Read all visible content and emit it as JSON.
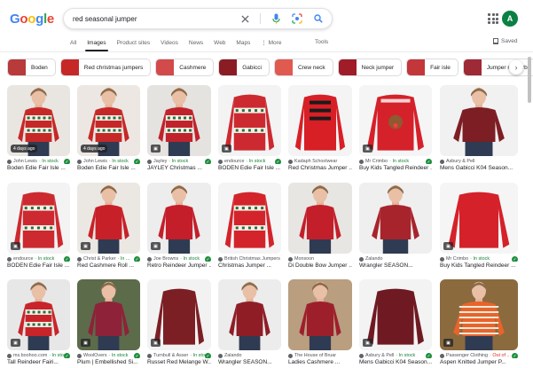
{
  "header": {
    "logo": [
      "G",
      "o",
      "o",
      "g",
      "l",
      "e"
    ],
    "query": "red seasonal jumper",
    "avatar_letter": "A"
  },
  "tabs": [
    {
      "label": "All",
      "active": false
    },
    {
      "label": "Images",
      "active": true
    },
    {
      "label": "Product sites",
      "active": false
    },
    {
      "label": "Videos",
      "active": false
    },
    {
      "label": "News",
      "active": false
    },
    {
      "label": "Web",
      "active": false
    },
    {
      "label": "Maps",
      "active": false
    },
    {
      "label": "⋮ More",
      "active": false
    }
  ],
  "tools_label": "Tools",
  "saved_label": "Saved",
  "chips": [
    {
      "label": "Boden",
      "color": "#b83a3a"
    },
    {
      "label": "Red christmas jumpers",
      "color": "#c62828"
    },
    {
      "label": "Cashmere",
      "color": "#d24a4a"
    },
    {
      "label": "Gabicci",
      "color": "#8a1c24"
    },
    {
      "label": "Crew neck",
      "color": "#e05a50"
    },
    {
      "label": "Neck jumper",
      "color": "#a01c28"
    },
    {
      "label": "Fair isle",
      "color": "#c3363a"
    },
    {
      "label": "Jumper rhubarb",
      "color": "#9e2a35"
    }
  ],
  "rows": [
    [
      {
        "source": "John Lewis",
        "stock": "In stock",
        "title": "Boden Edie Fair Isle ...",
        "badge": "4 days ago",
        "bg": "#e9e6e2",
        "item": "#c62828",
        "pattern": "fairisle",
        "model": true
      },
      {
        "source": "John Lewis",
        "stock": "In stock",
        "title": "Boden Edie Fair Isle ...",
        "badge": "4 days ago",
        "bg": "#ece7e3",
        "item": "#c62828",
        "pattern": "fairisle",
        "model": true
      },
      {
        "source": "Jayley",
        "stock": "In stock",
        "title": "JAYLEY Christmas ...",
        "badge": "",
        "bg": "#e5e3df",
        "item": "#c0232c",
        "pattern": "fairisle",
        "model": true
      },
      {
        "source": "endource",
        "stock": "In stock",
        "title": "BODEN Edie Fair Isle ...",
        "badge": "",
        "bg": "#f3f3f3",
        "item": "#cc2a30",
        "pattern": "fairisle",
        "model": false
      },
      {
        "source": "Kadaph Schoolwear",
        "stock": "",
        "title": "Red Christmas Jumper ...",
        "badge": "",
        "bg": "#f4f4f4",
        "item": "#d81f26",
        "pattern": "text",
        "model": false
      },
      {
        "source": "Mr Crimbo",
        "stock": "In stock",
        "title": "Buy Kids Tangled Reindeer ...",
        "badge": "",
        "bg": "#f5f5f5",
        "item": "#d5212a",
        "pattern": "reindeer",
        "model": false
      },
      {
        "source": "Asbury & Pell",
        "stock": "",
        "title": "Mens Gabicci K04 Season...",
        "badge": "",
        "bg": "#f1f1f1",
        "item": "#7d1e24",
        "pattern": "plain",
        "model": true
      }
    ],
    [
      {
        "source": "endource",
        "stock": "In stock",
        "title": "BODEN Edie Fair Isle ...",
        "badge": "",
        "bg": "#f3f3f3",
        "item": "#cc2a30",
        "pattern": "fairisle",
        "model": false
      },
      {
        "source": "Christ & Parker",
        "stock": "In ...",
        "title": "Red Cashmere Roll ...",
        "badge": "",
        "bg": "#ebe8e4",
        "item": "#c82028",
        "pattern": "plain",
        "model": true
      },
      {
        "source": "Joe Browns",
        "stock": "In stock",
        "title": "Retro Reindeer Jumper ...",
        "badge": "",
        "bg": "#ededed",
        "item": "#c41e2a",
        "pattern": "plain",
        "model": true
      },
      {
        "source": "British Christmas Jumpers",
        "stock": "",
        "title": "Christmas Jumper ...",
        "badge": "",
        "bg": "#f4f4f4",
        "item": "#d3242b",
        "pattern": "fairisle",
        "model": false
      },
      {
        "source": "Monsoon",
        "stock": "",
        "title": "Di Double Bow Jumper ...",
        "badge": "",
        "bg": "#e8e6e3",
        "item": "#c21f2b",
        "pattern": "plain",
        "model": true
      },
      {
        "source": "Zalando",
        "stock": "",
        "title": "Wrangler SEASON...",
        "badge": "",
        "bg": "#efefef",
        "item": "#a8242c",
        "pattern": "plain",
        "model": true
      },
      {
        "source": "Mr Crimbo",
        "stock": "In stock",
        "title": "Buy Kids Tangled Reindeer ...",
        "badge": "",
        "bg": "#f5f5f5",
        "item": "#d5212a",
        "pattern": "plain",
        "model": false
      }
    ],
    [
      {
        "source": "ms.boohoo.com",
        "stock": "In stock",
        "title": "Tall Reindeer Fairi...",
        "badge": "",
        "bg": "#e7e7e7",
        "item": "#c8242a",
        "pattern": "fairisle",
        "model": true
      },
      {
        "source": "WoolOvers",
        "stock": "In stock",
        "title": "Plum | Embellished Si...",
        "badge": "",
        "bg": "#5c6b4a",
        "item": "#8e2238",
        "pattern": "plain",
        "model": true
      },
      {
        "source": "Turnbull & Asser",
        "stock": "In stock",
        "title": "Russet Red Melange W...",
        "badge": "",
        "bg": "#f2f2f2",
        "item": "#7c1f24",
        "pattern": "plain",
        "model": false
      },
      {
        "source": "Zalando",
        "stock": "",
        "title": "Wrangler SEASON...",
        "badge": "",
        "bg": "#ececec",
        "item": "#8f1d26",
        "pattern": "plain",
        "model": true
      },
      {
        "source": "The House of Bruar",
        "stock": "",
        "title": "Ladies Cashmere ...",
        "badge": "",
        "bg": "#b99e80",
        "item": "#9e1f2c",
        "pattern": "plain",
        "model": true
      },
      {
        "source": "Asbury & Pell",
        "stock": "In stock",
        "title": "Mens Gabicci K04 Season...",
        "badge": "",
        "bg": "#f3f3f3",
        "item": "#6f1a22",
        "pattern": "plain",
        "model": false
      },
      {
        "source": "Passenger Clothing",
        "stock": "Out of ...",
        "title": "Aspen Knitted Jumper P...",
        "badge": "",
        "bg": "#8b6a3e",
        "item": "#e8642a",
        "pattern": "stripes",
        "model": true
      }
    ]
  ]
}
